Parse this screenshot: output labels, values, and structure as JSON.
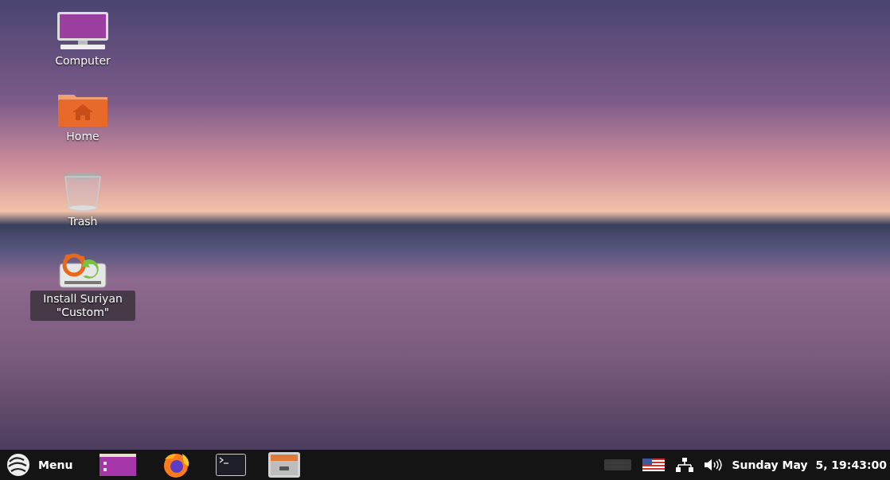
{
  "desktop_icons": [
    {
      "label": "Computer",
      "kind": "computer",
      "selected": false
    },
    {
      "label": "Home",
      "kind": "home-folder",
      "selected": false
    },
    {
      "label": "Trash",
      "kind": "trash",
      "selected": false
    },
    {
      "label": "Install Suriyan \"Custom\"",
      "kind": "installer",
      "selected": true
    }
  ],
  "taskbar": {
    "menu_label": "Menu",
    "launchers": [
      {
        "kind": "window"
      },
      {
        "kind": "browser"
      },
      {
        "kind": "terminal"
      },
      {
        "kind": "file-cabinet"
      }
    ]
  },
  "tray": {
    "clock": "Sunday May  5, 19:43:00"
  }
}
